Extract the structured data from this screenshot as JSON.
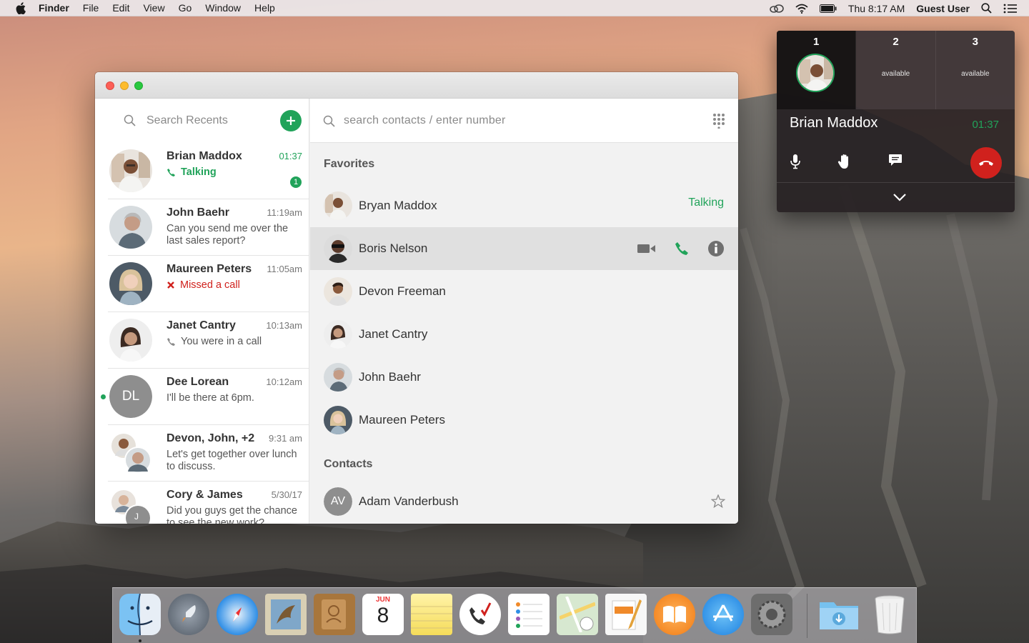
{
  "menubar": {
    "app_name": "Finder",
    "items": [
      "File",
      "Edit",
      "View",
      "Go",
      "Window",
      "Help"
    ],
    "clock": "Thu 8:17 AM",
    "user": "Guest User"
  },
  "recents": {
    "search_placeholder": "Search Recents",
    "items": [
      {
        "name": "Brian Maddox",
        "time": "01:37",
        "status": "Talking",
        "badge": "1"
      },
      {
        "name": "John Baehr",
        "time": "11:19am",
        "message": "Can you send me over the last sales report?"
      },
      {
        "name": "Maureen Peters",
        "time": "11:05am",
        "status": "Missed a call"
      },
      {
        "name": "Janet Cantry",
        "time": "10:13am",
        "status": "You were in a call"
      },
      {
        "name": "Dee Lorean",
        "time": "10:12am",
        "message": "I'll be there at 6pm.",
        "initials": "DL"
      },
      {
        "name": "Devon, John, +2",
        "time": "9:31 am",
        "message": "Let's get together over lunch to discuss."
      },
      {
        "name": "Cory & James",
        "time": "5/30/17",
        "message": "Did you guys get the chance to see the new work?",
        "initials": "J"
      }
    ]
  },
  "contacts": {
    "search_placeholder": "search contacts / enter number",
    "favorites_title": "Favorites",
    "favorites": [
      {
        "name": "Bryan Maddox",
        "status": "Talking"
      },
      {
        "name": "Boris Nelson"
      },
      {
        "name": "Devon Freeman"
      },
      {
        "name": "Janet Cantry"
      },
      {
        "name": "John Baehr"
      },
      {
        "name": "Maureen Peters"
      }
    ],
    "contacts_title": "Contacts",
    "list": [
      {
        "name": "Adam Vanderbush",
        "initials": "AV"
      }
    ]
  },
  "call_widget": {
    "slots": [
      {
        "number": "1"
      },
      {
        "number": "2",
        "label": "available"
      },
      {
        "number": "3",
        "label": "available"
      }
    ],
    "caller_name": "Brian Maddox",
    "timer": "01:37"
  },
  "dock": {
    "calendar_month": "JUN",
    "calendar_day": "8"
  },
  "colors": {
    "accent_green": "#21a35a",
    "missed_red": "#d0211d",
    "hangup_red": "#d0211d"
  }
}
